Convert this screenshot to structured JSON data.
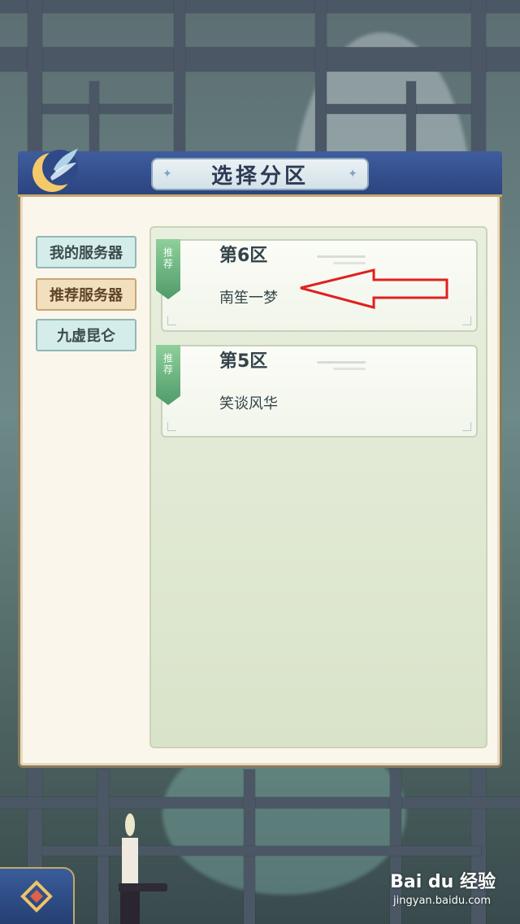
{
  "dialog": {
    "title": "选择分区"
  },
  "tabs": [
    {
      "label": "我的服务器",
      "active": false
    },
    {
      "label": "推荐服务器",
      "active": true
    },
    {
      "label": "九虚昆仑",
      "active": false
    }
  ],
  "servers": [
    {
      "zone": "第6区",
      "name": "南笙一梦",
      "tag": "推荐"
    },
    {
      "zone": "第5区",
      "name": "笑谈风华",
      "tag": "推荐"
    }
  ],
  "watermark": {
    "brand": "Bai du 经验",
    "url": "jingyan.baidu.com"
  },
  "colors": {
    "header_blue": "#2c4480",
    "active_tab": "#f1dfbe",
    "tab": "#d4ecea",
    "annotation_red": "#e02020"
  },
  "icons": {
    "back": "back-diamond-icon",
    "tag": "recommend-ribbon"
  }
}
